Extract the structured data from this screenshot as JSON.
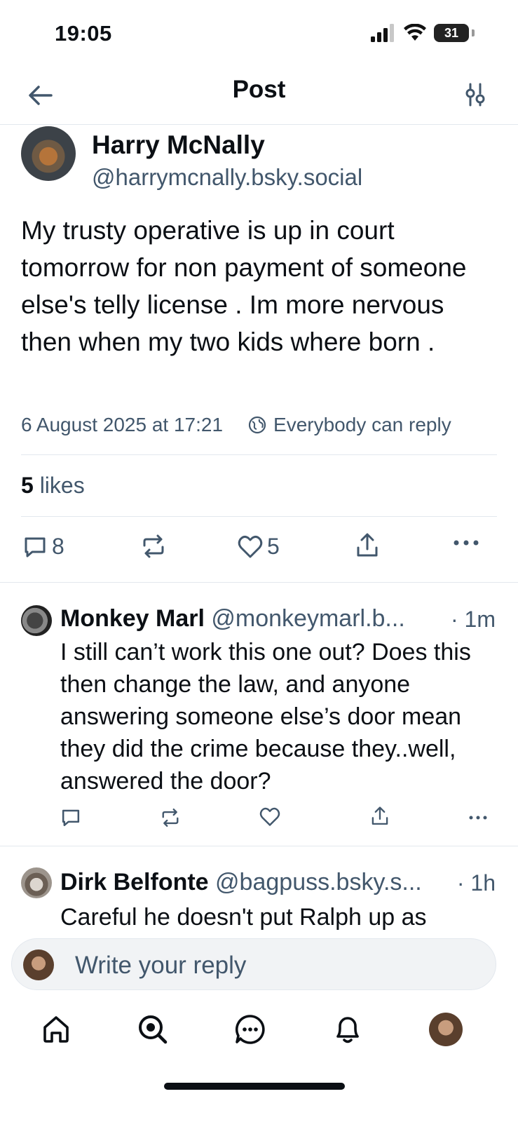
{
  "status_bar": {
    "time": "19:05",
    "battery": "31"
  },
  "header": {
    "title": "Post"
  },
  "post": {
    "author_name": "Harry McNally",
    "author_handle": "@harrymcnally.bsky.social",
    "text": "My trusty operative is up in court tomorrow for non payment of someone else's telly license . Im more nervous then when my two kids where born .",
    "timestamp": "6 August 2025 at 17:21",
    "reply_setting": "Everybody can reply",
    "likes_count": "5",
    "likes_label": "likes",
    "reply_count": "8",
    "like_count": "5"
  },
  "replies": [
    {
      "name": "Monkey Marl",
      "handle": "@monkeymarl.b...",
      "time": "· 1m",
      "text": "I still can’t work this one out? Does this then change the law, and anyone answering someone else’s door mean they did the crime because they..well, answered the door?"
    },
    {
      "name": "Dirk Belfonte",
      "handle": "@bagpuss.bsky.s...",
      "time": "· 1h",
      "text": "Careful he doesn't put Ralph up as"
    }
  ],
  "composer": {
    "placeholder": "Write your reply"
  },
  "colors": {
    "text": "#0b0f14",
    "muted": "#42576c",
    "divider": "#e3e8ee"
  },
  "icons": [
    "back-arrow-icon",
    "settings-sliders-icon",
    "globe-icon",
    "comment-icon",
    "repost-icon",
    "heart-icon",
    "share-icon",
    "more-icon",
    "home-icon",
    "search-icon",
    "chat-icon",
    "bell-icon"
  ]
}
